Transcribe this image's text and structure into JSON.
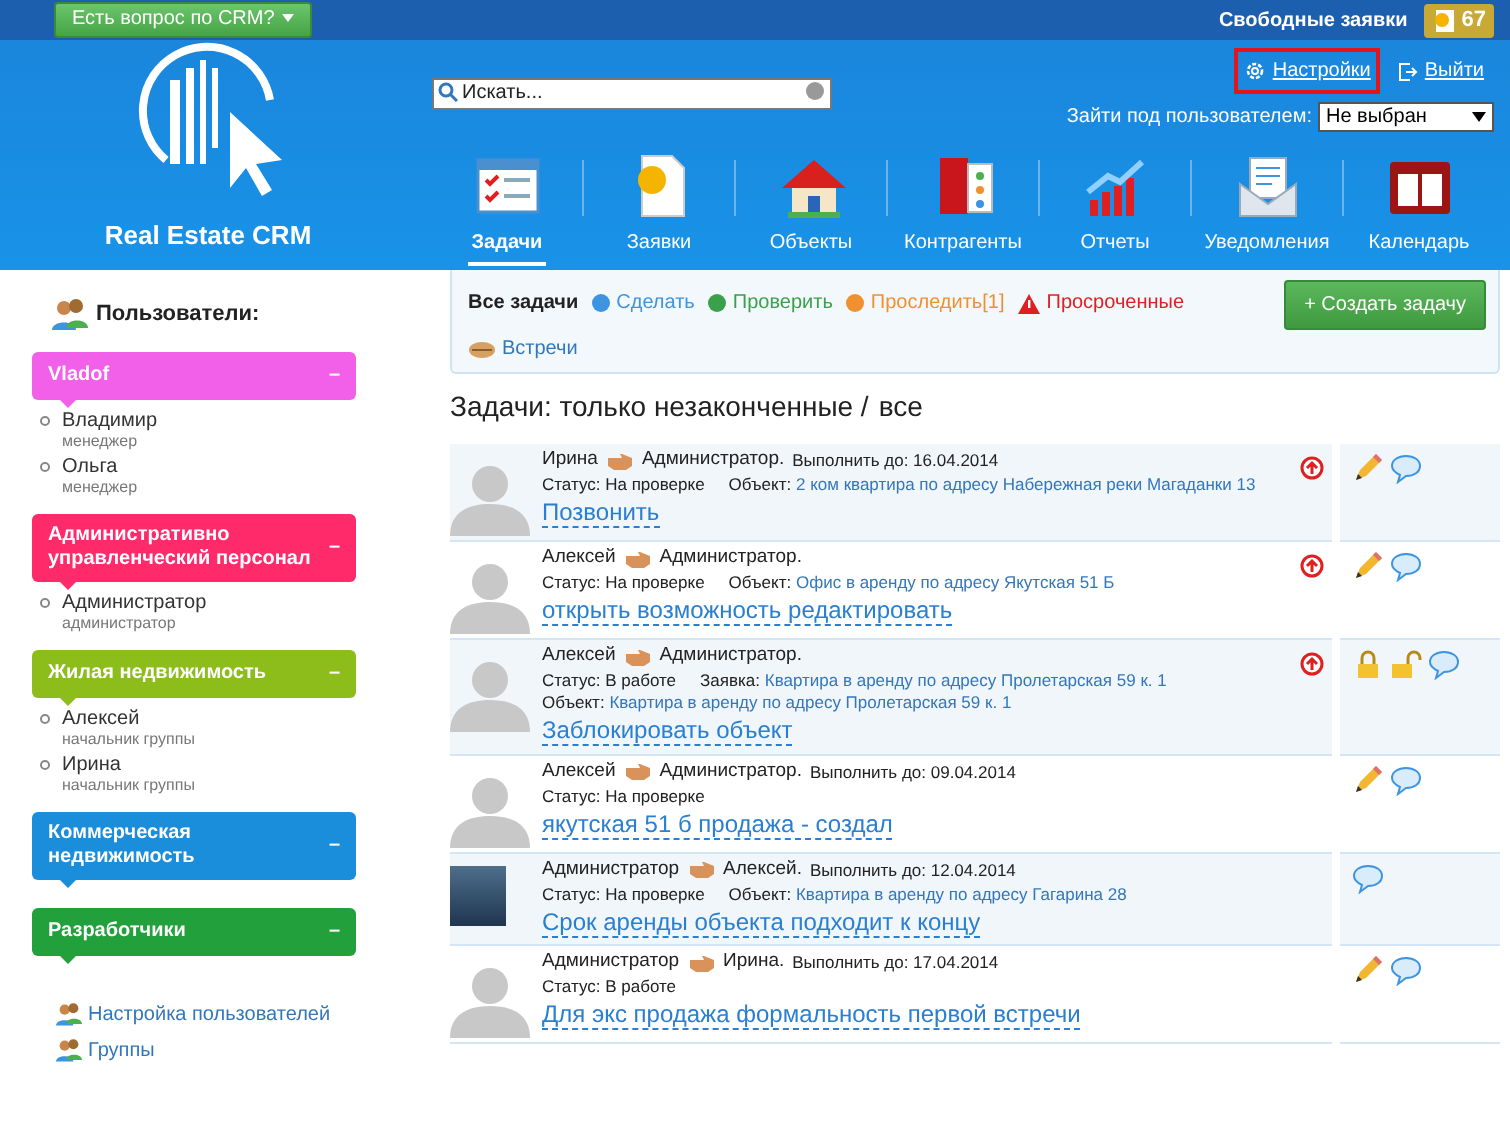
{
  "topbar": {
    "question_button": "Есть вопрос по CRM?",
    "free_requests_label": "Свободные заявки",
    "free_requests_count": "67"
  },
  "header": {
    "logo_text": "Real Estate CRM",
    "search": {
      "placeholder": "Искать..."
    },
    "settings_link": {
      "label": "Настройки",
      "highlighted": true
    },
    "logout_link": "Выйти",
    "login_as": {
      "label": "Зайти под пользователем:",
      "value": "Не выбран"
    },
    "nav": [
      {
        "label": "Задачи",
        "kind": "tasks",
        "selected": true
      },
      {
        "label": "Заявки",
        "kind": "requests",
        "selected": false
      },
      {
        "label": "Объекты",
        "kind": "objects",
        "selected": false
      },
      {
        "label": "Контрагенты",
        "kind": "contacts",
        "selected": false
      },
      {
        "label": "Отчеты",
        "kind": "reports",
        "selected": false
      },
      {
        "label": "Уведомления",
        "kind": "notifications",
        "selected": false
      },
      {
        "label": "Календарь",
        "kind": "calendar",
        "selected": false
      }
    ]
  },
  "sidebar": {
    "title": "Пользователи:",
    "groups": [
      {
        "name": "Vladof",
        "color": "#f25fe8",
        "collapse": "–",
        "members": [
          {
            "name": "Владимир",
            "role": "менеджер"
          },
          {
            "name": "Ольга",
            "role": "менеджер"
          }
        ]
      },
      {
        "name": "Административно управленческий персонал",
        "color": "#ff2a6a",
        "collapse": "–",
        "members": [
          {
            "name": "Администратор",
            "role": "администратор"
          }
        ]
      },
      {
        "name": "Жилая недвижимость",
        "color": "#8cbd1a",
        "collapse": "–",
        "members": [
          {
            "name": "Алексей",
            "role": "начальник группы"
          },
          {
            "name": "Ирина",
            "role": "начальник группы"
          }
        ]
      },
      {
        "name": "Коммерческая недвижимость",
        "color": "#1a8ddb",
        "collapse": "–"
      },
      {
        "name": "Разработчики",
        "color": "#22a03c",
        "collapse": "–"
      }
    ],
    "links": [
      "Настройка пользователей",
      "Группы"
    ]
  },
  "filters": [
    {
      "label": "Все задачи",
      "kind": "plain",
      "color": "#222222",
      "selected": true
    },
    {
      "label": "Сделать",
      "kind": "dot",
      "color": "#3d94e0",
      "selected": false
    },
    {
      "label": "Проверить",
      "kind": "dot",
      "color": "#3aa14a",
      "selected": false
    },
    {
      "label": "Проследить[1]",
      "kind": "dot",
      "color": "#f09030",
      "selected": false
    },
    {
      "label": "Просроченные",
      "kind": "warning",
      "color": "#e02020",
      "selected": false
    },
    {
      "label": "Встречи",
      "kind": "meetings",
      "color": "#3377bb",
      "selected": false
    }
  ],
  "create_button": "+ Создать задачу",
  "heading": {
    "text": "Задачи: только незаконченные /",
    "link": "все"
  },
  "tasks": [
    {
      "avatar": {
        "kind": "silhouette"
      },
      "from": "Ирина",
      "to": "Администратор.",
      "due": "Выполнить до: 16.04.2014",
      "status": "Статус: На проверке",
      "refs": [
        {
          "label": "Объект:",
          "value": "2 ком квартира по адресу Набережная реки Магаданки 13"
        }
      ],
      "title": "Позвонить",
      "priority": true,
      "actions": [
        {
          "kind": "edit"
        },
        {
          "kind": "comment"
        }
      ]
    },
    {
      "avatar": {
        "kind": "silhouette"
      },
      "from": "Алексей",
      "to": "Администратор.",
      "status": "Статус: На проверке",
      "refs": [
        {
          "label": "Объект:",
          "value": "Офис в аренду по адресу Якутская 51 Б"
        }
      ],
      "title": "открыть возможность редактировать",
      "priority": true,
      "actions": [
        {
          "kind": "edit"
        },
        {
          "kind": "comment"
        }
      ]
    },
    {
      "avatar": {
        "kind": "silhouette"
      },
      "from": "Алексей",
      "to": "Администратор.",
      "status": "Статус: В работе",
      "refs": [
        {
          "label": "Заявка:",
          "value": "Квартира в аренду по адресу Пролетарская 59 к. 1"
        },
        {
          "label": "Объект:",
          "value": "Квартира в аренду по адресу Пролетарская 59 к. 1"
        }
      ],
      "title": "Заблокировать объект",
      "priority": true,
      "actions": [
        {
          "kind": "lock"
        },
        {
          "kind": "unlock"
        },
        {
          "kind": "comment"
        }
      ]
    },
    {
      "avatar": {
        "kind": "silhouette"
      },
      "from": "Алексей",
      "to": "Администратор.",
      "due": "Выполнить до: 09.04.2014",
      "status": "Статус: На проверке",
      "title": "якутская 51 б продажа - создал",
      "priority": false,
      "actions": [
        {
          "kind": "edit"
        },
        {
          "kind": "comment"
        }
      ]
    },
    {
      "avatar": {
        "kind": "photo"
      },
      "from": "Администратор",
      "to": "Алексей.",
      "due": "Выполнить до: 12.04.2014",
      "status": "Статус: На проверке",
      "refs": [
        {
          "label": "Объект:",
          "value": "Квартира в аренду по адресу Гагарина 28"
        }
      ],
      "title": "Срок аренды объекта подходит к концу",
      "priority": false,
      "actions": [
        {
          "kind": "comment"
        }
      ]
    },
    {
      "avatar": {
        "kind": "silhouette"
      },
      "from": "Администратор",
      "to": "Ирина.",
      "due": "Выполнить до: 17.04.2014",
      "status": "Статус: В работе",
      "title": "Для экс продажа формальность первой встречи",
      "priority": false,
      "actions": [
        {
          "kind": "edit"
        },
        {
          "kind": "comment"
        }
      ]
    }
  ]
}
